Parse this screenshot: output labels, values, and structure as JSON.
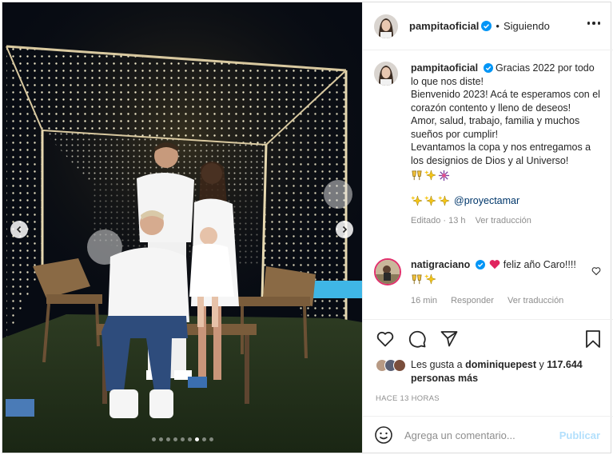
{
  "post": {
    "username": "pampitaoficial",
    "follow_sep": "•",
    "follow_status": "Siguiendo",
    "carousel": {
      "dot_count": 9,
      "active_index": 6
    }
  },
  "caption": {
    "username": "pampitaoficial",
    "lines": [
      "Gracias 2022 por todo lo que nos diste!",
      "Bienvenido 2023! Acá te esperamos con el corazón contento y lleno de deseos!",
      "Amor, salud, trabajo, familia y muchos sueños por cumplir!",
      "Levantamos la copa y nos entregamos a los designios de Dios y al Universo!"
    ],
    "emojis_1": [
      "toast-icon",
      "sparkles-icon",
      "firework-icon"
    ],
    "emojis_2": [
      "sparkles-icon",
      "sparkles-icon",
      "sparkles-icon"
    ],
    "mention": "@proyectamar",
    "edited": "Editado · 13 h",
    "see_translation": "Ver traducción"
  },
  "comment": {
    "username": "natigraciano",
    "text": "feliz año Caro!!!!",
    "emojis": [
      "toast-icon",
      "sparkles-icon"
    ],
    "time": "16 min",
    "reply": "Responder",
    "see_translation": "Ver traducción"
  },
  "likes": {
    "prefix": "Les gusta a",
    "user": "dominiquepest",
    "suffix": "y",
    "others": "117.644 personas más"
  },
  "time_ago": "HACE 13 HORAS",
  "comment_input": {
    "placeholder": "Agrega un comentario...",
    "publish": "Publicar"
  },
  "colors": {
    "verified": "#0095f6",
    "link": "#00376b",
    "muted": "#8e8e8e",
    "publish_disabled": "#b2dffc",
    "heart_emoji": "#e0245e"
  }
}
